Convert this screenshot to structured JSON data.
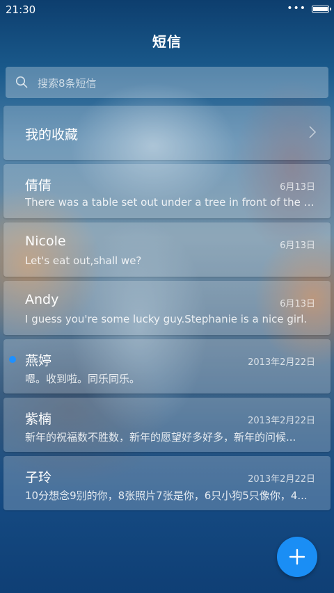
{
  "status_bar": {
    "time": "21:30",
    "signal_dots": "•••",
    "battery_icon": "battery-icon"
  },
  "header": {
    "title": "短信"
  },
  "search": {
    "placeholder": "搜索8条短信",
    "icon": "search-icon"
  },
  "favorites": {
    "label": "我的收藏",
    "icon": "chevron-right-icon"
  },
  "messages": [
    {
      "name": "倩倩",
      "date": "6月13日",
      "preview": "There was a table set out under a tree in front of the ho...",
      "unread": false
    },
    {
      "name": "Nicole",
      "date": "6月13日",
      "preview": "Let's eat out,shall we?",
      "unread": false
    },
    {
      "name": "Andy",
      "date": "6月13日",
      "preview": "I guess you're some lucky guy.Stephanie is a nice girl.",
      "unread": false
    },
    {
      "name": "燕婷",
      "date": "2013年2月22日",
      "preview": "嗯。收到啦。同乐同乐。",
      "unread": true
    },
    {
      "name": "紫楠",
      "date": "2013年2月22日",
      "preview": "新年的祝福数不胜数，新年的愿望好多好多，新年的问候...",
      "unread": false
    },
    {
      "name": "子玲",
      "date": "2013年2月22日",
      "preview": "10分想念9别的你，8张照片7张是你，6只小狗5只像你，4...",
      "unread": false
    }
  ],
  "fab": {
    "icon": "plus-icon"
  },
  "colors": {
    "accent": "#1a8ef5",
    "unread_dot": "#1e90ff"
  }
}
